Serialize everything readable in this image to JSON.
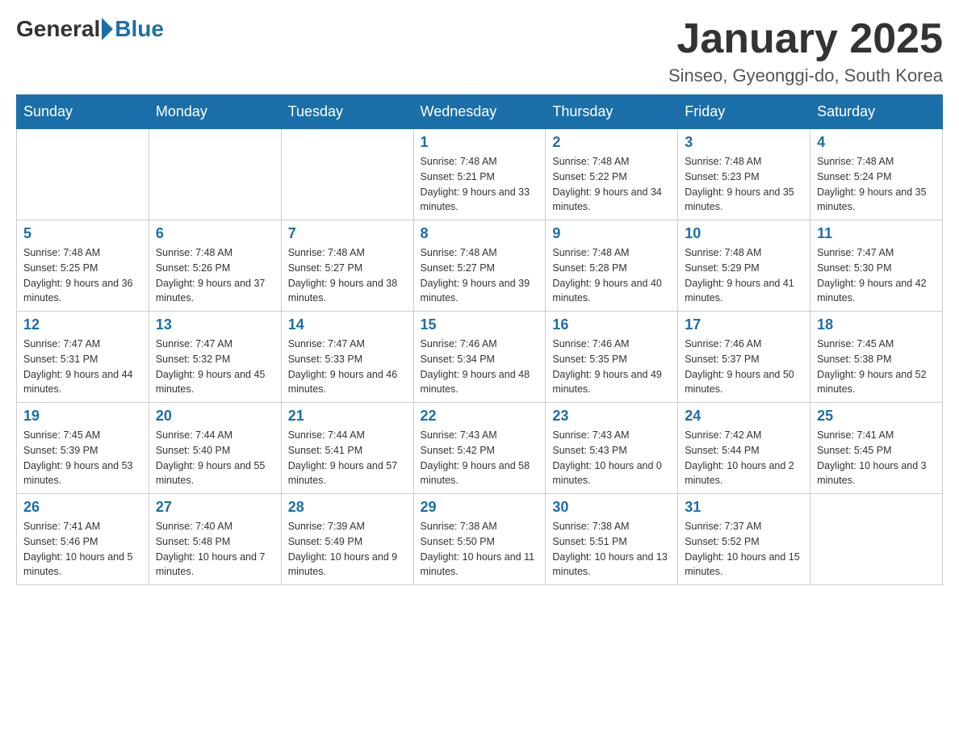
{
  "logo": {
    "general": "General",
    "blue": "Blue"
  },
  "title": "January 2025",
  "location": "Sinseo, Gyeonggi-do, South Korea",
  "days_of_week": [
    "Sunday",
    "Monday",
    "Tuesday",
    "Wednesday",
    "Thursday",
    "Friday",
    "Saturday"
  ],
  "weeks": [
    [
      {
        "day": "",
        "sunrise": "",
        "sunset": "",
        "daylight": ""
      },
      {
        "day": "",
        "sunrise": "",
        "sunset": "",
        "daylight": ""
      },
      {
        "day": "",
        "sunrise": "",
        "sunset": "",
        "daylight": ""
      },
      {
        "day": "1",
        "sunrise": "Sunrise: 7:48 AM",
        "sunset": "Sunset: 5:21 PM",
        "daylight": "Daylight: 9 hours and 33 minutes."
      },
      {
        "day": "2",
        "sunrise": "Sunrise: 7:48 AM",
        "sunset": "Sunset: 5:22 PM",
        "daylight": "Daylight: 9 hours and 34 minutes."
      },
      {
        "day": "3",
        "sunrise": "Sunrise: 7:48 AM",
        "sunset": "Sunset: 5:23 PM",
        "daylight": "Daylight: 9 hours and 35 minutes."
      },
      {
        "day": "4",
        "sunrise": "Sunrise: 7:48 AM",
        "sunset": "Sunset: 5:24 PM",
        "daylight": "Daylight: 9 hours and 35 minutes."
      }
    ],
    [
      {
        "day": "5",
        "sunrise": "Sunrise: 7:48 AM",
        "sunset": "Sunset: 5:25 PM",
        "daylight": "Daylight: 9 hours and 36 minutes."
      },
      {
        "day": "6",
        "sunrise": "Sunrise: 7:48 AM",
        "sunset": "Sunset: 5:26 PM",
        "daylight": "Daylight: 9 hours and 37 minutes."
      },
      {
        "day": "7",
        "sunrise": "Sunrise: 7:48 AM",
        "sunset": "Sunset: 5:27 PM",
        "daylight": "Daylight: 9 hours and 38 minutes."
      },
      {
        "day": "8",
        "sunrise": "Sunrise: 7:48 AM",
        "sunset": "Sunset: 5:27 PM",
        "daylight": "Daylight: 9 hours and 39 minutes."
      },
      {
        "day": "9",
        "sunrise": "Sunrise: 7:48 AM",
        "sunset": "Sunset: 5:28 PM",
        "daylight": "Daylight: 9 hours and 40 minutes."
      },
      {
        "day": "10",
        "sunrise": "Sunrise: 7:48 AM",
        "sunset": "Sunset: 5:29 PM",
        "daylight": "Daylight: 9 hours and 41 minutes."
      },
      {
        "day": "11",
        "sunrise": "Sunrise: 7:47 AM",
        "sunset": "Sunset: 5:30 PM",
        "daylight": "Daylight: 9 hours and 42 minutes."
      }
    ],
    [
      {
        "day": "12",
        "sunrise": "Sunrise: 7:47 AM",
        "sunset": "Sunset: 5:31 PM",
        "daylight": "Daylight: 9 hours and 44 minutes."
      },
      {
        "day": "13",
        "sunrise": "Sunrise: 7:47 AM",
        "sunset": "Sunset: 5:32 PM",
        "daylight": "Daylight: 9 hours and 45 minutes."
      },
      {
        "day": "14",
        "sunrise": "Sunrise: 7:47 AM",
        "sunset": "Sunset: 5:33 PM",
        "daylight": "Daylight: 9 hours and 46 minutes."
      },
      {
        "day": "15",
        "sunrise": "Sunrise: 7:46 AM",
        "sunset": "Sunset: 5:34 PM",
        "daylight": "Daylight: 9 hours and 48 minutes."
      },
      {
        "day": "16",
        "sunrise": "Sunrise: 7:46 AM",
        "sunset": "Sunset: 5:35 PM",
        "daylight": "Daylight: 9 hours and 49 minutes."
      },
      {
        "day": "17",
        "sunrise": "Sunrise: 7:46 AM",
        "sunset": "Sunset: 5:37 PM",
        "daylight": "Daylight: 9 hours and 50 minutes."
      },
      {
        "day": "18",
        "sunrise": "Sunrise: 7:45 AM",
        "sunset": "Sunset: 5:38 PM",
        "daylight": "Daylight: 9 hours and 52 minutes."
      }
    ],
    [
      {
        "day": "19",
        "sunrise": "Sunrise: 7:45 AM",
        "sunset": "Sunset: 5:39 PM",
        "daylight": "Daylight: 9 hours and 53 minutes."
      },
      {
        "day": "20",
        "sunrise": "Sunrise: 7:44 AM",
        "sunset": "Sunset: 5:40 PM",
        "daylight": "Daylight: 9 hours and 55 minutes."
      },
      {
        "day": "21",
        "sunrise": "Sunrise: 7:44 AM",
        "sunset": "Sunset: 5:41 PM",
        "daylight": "Daylight: 9 hours and 57 minutes."
      },
      {
        "day": "22",
        "sunrise": "Sunrise: 7:43 AM",
        "sunset": "Sunset: 5:42 PM",
        "daylight": "Daylight: 9 hours and 58 minutes."
      },
      {
        "day": "23",
        "sunrise": "Sunrise: 7:43 AM",
        "sunset": "Sunset: 5:43 PM",
        "daylight": "Daylight: 10 hours and 0 minutes."
      },
      {
        "day": "24",
        "sunrise": "Sunrise: 7:42 AM",
        "sunset": "Sunset: 5:44 PM",
        "daylight": "Daylight: 10 hours and 2 minutes."
      },
      {
        "day": "25",
        "sunrise": "Sunrise: 7:41 AM",
        "sunset": "Sunset: 5:45 PM",
        "daylight": "Daylight: 10 hours and 3 minutes."
      }
    ],
    [
      {
        "day": "26",
        "sunrise": "Sunrise: 7:41 AM",
        "sunset": "Sunset: 5:46 PM",
        "daylight": "Daylight: 10 hours and 5 minutes."
      },
      {
        "day": "27",
        "sunrise": "Sunrise: 7:40 AM",
        "sunset": "Sunset: 5:48 PM",
        "daylight": "Daylight: 10 hours and 7 minutes."
      },
      {
        "day": "28",
        "sunrise": "Sunrise: 7:39 AM",
        "sunset": "Sunset: 5:49 PM",
        "daylight": "Daylight: 10 hours and 9 minutes."
      },
      {
        "day": "29",
        "sunrise": "Sunrise: 7:38 AM",
        "sunset": "Sunset: 5:50 PM",
        "daylight": "Daylight: 10 hours and 11 minutes."
      },
      {
        "day": "30",
        "sunrise": "Sunrise: 7:38 AM",
        "sunset": "Sunset: 5:51 PM",
        "daylight": "Daylight: 10 hours and 13 minutes."
      },
      {
        "day": "31",
        "sunrise": "Sunrise: 7:37 AM",
        "sunset": "Sunset: 5:52 PM",
        "daylight": "Daylight: 10 hours and 15 minutes."
      },
      {
        "day": "",
        "sunrise": "",
        "sunset": "",
        "daylight": ""
      }
    ]
  ]
}
